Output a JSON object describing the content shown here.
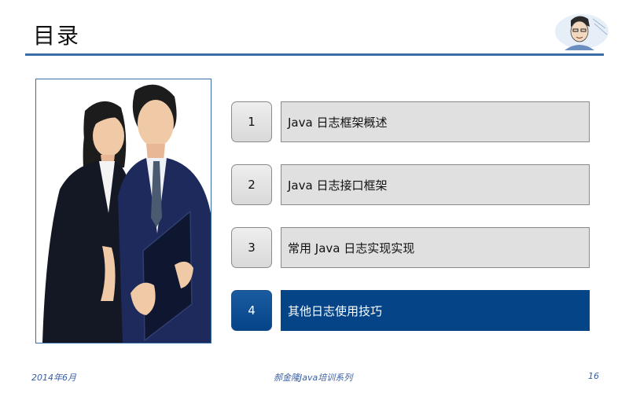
{
  "slide": {
    "title": "目录",
    "page_number": "16"
  },
  "toc": {
    "items": [
      {
        "num": "1",
        "label": "Java 日志框架概述"
      },
      {
        "num": "2",
        "label": "Java 日志接口框架"
      },
      {
        "num": "3",
        "label": "常用 Java 日志实现实现"
      },
      {
        "num": "4",
        "label": "其他日志使用技巧"
      }
    ],
    "active_index": 3
  },
  "footer": {
    "date": "2014年6月",
    "series": "郝金隆Java培训系列"
  },
  "colors": {
    "accent": "#064488",
    "rule": "#3a6ea5",
    "box_fill": "#e0e0e0"
  },
  "icons": {
    "avatar": "presenter-portrait-sketch",
    "photo": "business-people-illustration"
  }
}
